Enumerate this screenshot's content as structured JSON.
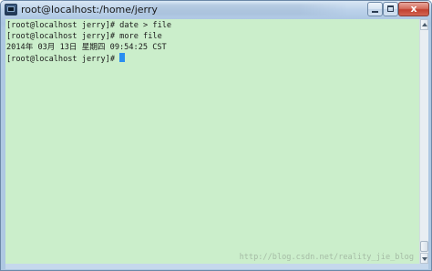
{
  "window": {
    "title": "root@localhost:/home/jerry",
    "close_glyph": "x",
    "icon": "putty-terminal-icon"
  },
  "terminal": {
    "background": "#cbeecb",
    "foreground": "#1a1a1a",
    "cursor_color": "#2a8ef0",
    "lines": [
      "[root@localhost jerry]# date > file",
      "[root@localhost jerry]# more file",
      "2014年 03月 13日 星期四 09:54:25 CST",
      "[root@localhost jerry]#"
    ]
  },
  "watermark": "http://blog.csdn.net/reality_jie_blog"
}
